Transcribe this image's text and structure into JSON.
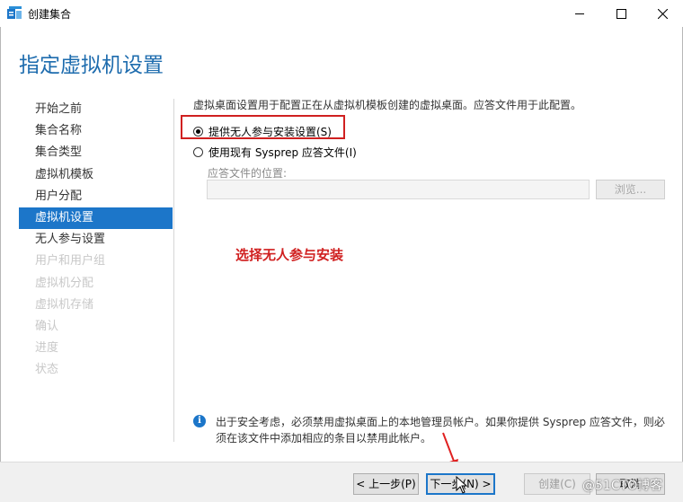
{
  "window": {
    "title": "创建集合",
    "page_title": "指定虚拟机设置"
  },
  "nav": {
    "items": [
      {
        "label": "开始之前",
        "state": "normal"
      },
      {
        "label": "集合名称",
        "state": "normal"
      },
      {
        "label": "集合类型",
        "state": "normal"
      },
      {
        "label": "虚拟机模板",
        "state": "normal"
      },
      {
        "label": "用户分配",
        "state": "normal"
      },
      {
        "label": "虚拟机设置",
        "state": "active"
      },
      {
        "label": "无人参与设置",
        "state": "normal"
      },
      {
        "label": "用户和用户组",
        "state": "disabled"
      },
      {
        "label": "虚拟机分配",
        "state": "disabled"
      },
      {
        "label": "虚拟机存储",
        "state": "disabled"
      },
      {
        "label": "确认",
        "state": "disabled"
      },
      {
        "label": "进度",
        "state": "disabled"
      },
      {
        "label": "状态",
        "state": "disabled"
      }
    ]
  },
  "content": {
    "intro": "虚拟桌面设置用于配置正在从虚拟机模板创建的虚拟桌面。应答文件用于此配置。",
    "option_unattended": "提供无人参与安装设置(S)",
    "option_sysprep": "使用现有 Sysprep 应答文件(I)",
    "answer_file_label": "应答文件的位置:",
    "answer_file_value": "",
    "browse_label": "浏览...",
    "annotation": "选择无人参与安装",
    "info_icon_glyph": "i",
    "info_text": "出于安全考虑，必须禁用虚拟桌面上的本地管理员帐户。如果你提供 Sysprep 应答文件，则必须在该文件中添加相应的条目以禁用此帐户。"
  },
  "footer": {
    "prev_label": "< 上一步(P)",
    "next_label": "下一步(N) >",
    "create_label": "创建(C)",
    "cancel_label": "取消"
  },
  "watermark": "@51CTO博客",
  "colors": {
    "title_blue": "#1e6cae",
    "active_nav": "#1c76c9",
    "annotation_red": "#d02020"
  }
}
